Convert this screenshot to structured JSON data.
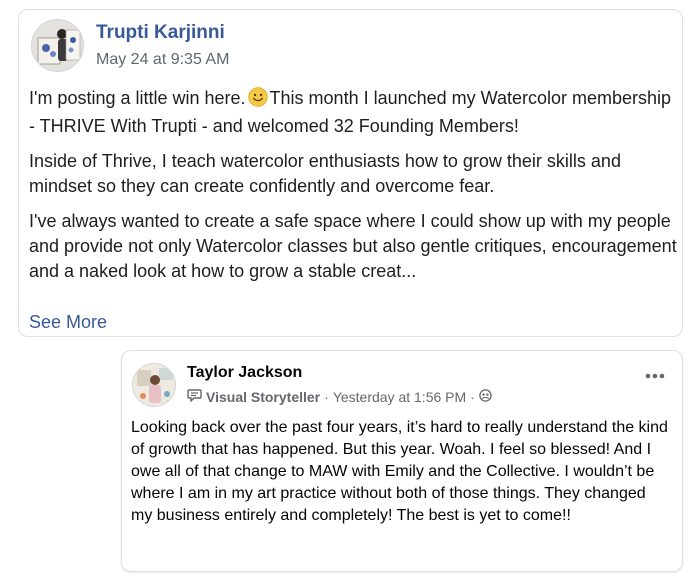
{
  "post1": {
    "author": "Trupti Karjinni",
    "date": "May 24 at 9:35 AM",
    "p1_before": "I'm posting a little win here.",
    "p1_after": "This month I launched my Watercolor membership - THRIVE With Trupti - and welcomed 32 Founding Members!",
    "p2": "Inside of Thrive, I teach watercolor enthusiasts how to grow their skills and mindset so they can create confidently and overcome fear.",
    "p3": "I've always wanted to create a safe space where I could show up with my people and provide not only Watercolor classes but also gentle critiques, encouragement and a naked look at how to grow a stable creat...",
    "see_more": "See More",
    "emoji_icon": "smiley-face-icon"
  },
  "post2": {
    "author": "Taylor Jackson",
    "badge_icon": "chat-bubble-icon",
    "role": "Visual Storyteller",
    "time": "Yesterday at 1:56 PM",
    "separator": "·",
    "audience_icon": "group-icon",
    "more_icon": "more-options-icon",
    "text": "Looking back over the past four years, it’s hard to really understand the kind of growth that has happened. But this year. Woah. I feel so blessed! And I owe all of that change to MAW with Emily and the Collective. I wouldn’t be where I am in my art practice without both of those things. They changed my business entirely and completely! The best is yet to come!!"
  },
  "colors": {
    "link_blue": "#385898",
    "secondary_text": "#606770",
    "border": "#dddfe2",
    "emoji_yellow": "#f7c948"
  }
}
